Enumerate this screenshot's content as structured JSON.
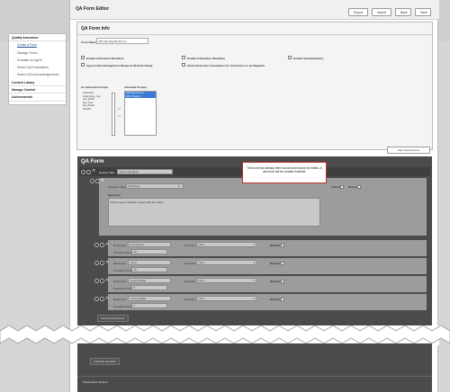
{
  "nav": {
    "items": [
      {
        "label": "Quality Assurance",
        "type": "main"
      },
      {
        "label": "Create a Form",
        "type": "sub"
      },
      {
        "label": "Manage Forms",
        "type": "sub"
      },
      {
        "label": "Evaluate an Agent",
        "type": "sub"
      },
      {
        "label": "Search QA Evaluations",
        "type": "sub"
      },
      {
        "label": "Search QA Acknowledgements",
        "type": "sub"
      },
      {
        "label": "Content Library",
        "type": "main"
      },
      {
        "label": "Manage Content",
        "type": "main"
      },
      {
        "label": "Achievements",
        "type": "main"
      }
    ]
  },
  "header": {
    "title": "QA Form Editor",
    "buttons": {
      "export": "Export",
      "import": "Import",
      "back": "Back",
      "save": "Save"
    }
  },
  "form_info": {
    "title": "QA Form Info",
    "form_name_label": "Form Name:",
    "form_name_value": "WFI QA Reg Bnd Form",
    "checks": {
      "arbitration": "Enable Arbitration Workflow",
      "calibration": "Enable Calibration Workflow",
      "self_eval": "Enable Self-Evaluation",
      "ack_required": "Agent Acknowledgement Required (Default Value)",
      "deduction": "Allow Deduction Calculation for Total Score to be Negative"
    },
    "unattached_label": "Un-Attached Groups",
    "attached_label": "Attached Groups",
    "unattached_groups": [
      "AndyTest",
      "Columbus_GA",
      "GA_2016",
      "Ga_Test",
      "Ga_Test2",
      "Test09"
    ],
    "attached_groups": [
      "WFI QA Group",
      "WFI Testing"
    ],
    "after_scored_btn": "After Scored Form"
  },
  "qa_form": {
    "title": "QA Form",
    "section_title_label": "Section Title:",
    "section_title_value": "Tippd_Litregthen",
    "alert": "This form has already been scored and cannot be edited. A new form will be created if altered.",
    "question_type_label": "Question Type:",
    "question_type_value": "Dropdown",
    "critical_label": "Critical:",
    "bonus_label": "Bonus:",
    "question_label": "Question:",
    "question_value": "Did the agent establish rapport with the caller?",
    "responses": [
      {
        "label": "Response:",
        "value": "Exceptional",
        "auto_fail_label": "Auto Fail:",
        "auto_fail": "None",
        "default_label": "Default:",
        "points_label": "Possible Points:",
        "points": "15"
      },
      {
        "label": "Response:",
        "value": "Good",
        "auto_fail_label": "Auto Fail:",
        "auto_fail": "None",
        "default_label": "Default:",
        "points_label": "Possible Points:",
        "points": "10"
      },
      {
        "label": "Response:",
        "value": "Unacceptable",
        "auto_fail_label": "Auto Fail:",
        "auto_fail": "None",
        "default_label": "Default:",
        "points_label": "Possible Points:",
        "points": "5"
      },
      {
        "label": "Response:",
        "value": "Unacceptable",
        "auto_fail_label": "Auto Fail:",
        "auto_fail": "None",
        "default_label": "Default:",
        "points_label": "Possible Points:",
        "points": "0"
      }
    ],
    "add_response": "Add New Response",
    "add_question": "Add New Question",
    "add_section": "Create New Section"
  }
}
